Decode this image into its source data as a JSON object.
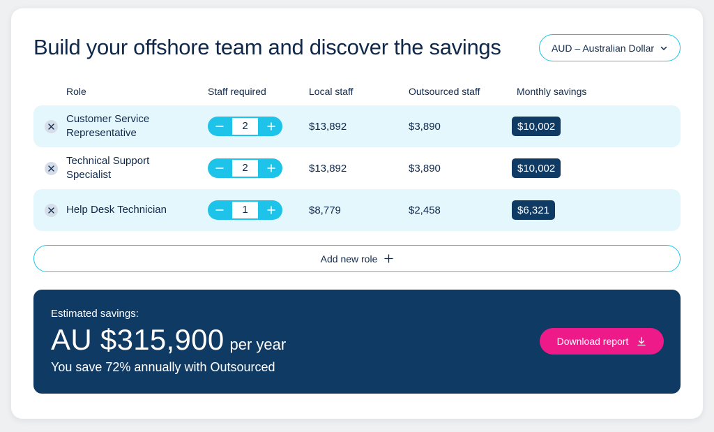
{
  "title": "Build your offshore team and discover the savings",
  "currency": {
    "label": "AUD – Australian Dollar"
  },
  "columns": {
    "role": "Role",
    "staff": "Staff required",
    "local": "Local staff",
    "outsourced": "Outsourced staff",
    "savings": "Monthly savings"
  },
  "rows": [
    {
      "role_line1": "Customer Service",
      "role_line2": "Representative",
      "staff": "2",
      "local": "$13,892",
      "outsourced": "$3,890",
      "savings": "$10,002"
    },
    {
      "role_line1": "Technical Support",
      "role_line2": "Specialist",
      "staff": "2",
      "local": "$13,892",
      "outsourced": "$3,890",
      "savings": "$10,002"
    },
    {
      "role_line1": "Help Desk Technician",
      "role_line2": "",
      "staff": "1",
      "local": "$8,779",
      "outsourced": "$2,458",
      "savings": "$6,321"
    }
  ],
  "add_role_label": "Add new role",
  "summary": {
    "label": "Estimated savings:",
    "amount": "AU $315,900",
    "period": "per year",
    "subtext": "You save 72% annually with Outsourced",
    "download_label": "Download report"
  },
  "colors": {
    "accent": "#1ec3ea",
    "navy": "#0f3a64",
    "row_highlight": "#e4f7fd",
    "cta": "#ee1a8a",
    "text": "#10294b"
  }
}
